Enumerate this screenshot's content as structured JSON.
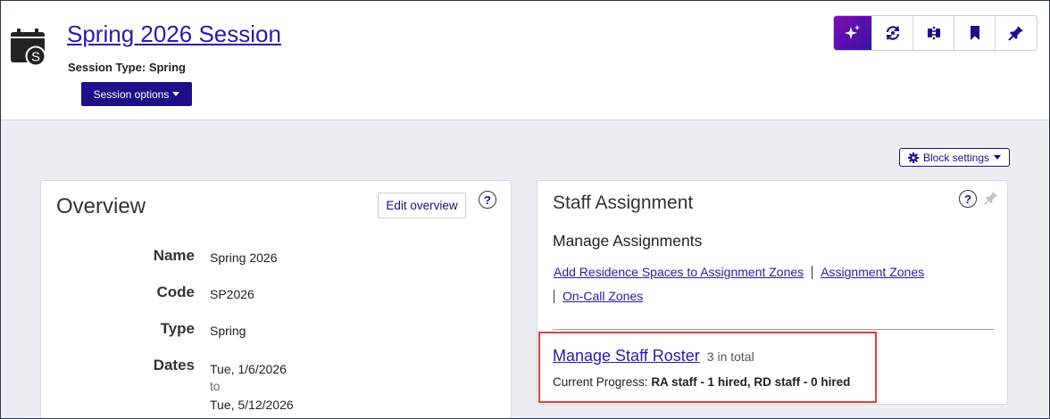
{
  "header": {
    "session_title": "Spring 2026 Session",
    "session_type_label": "Session Type:",
    "session_type_value": "Spring",
    "session_options_label": "Session options"
  },
  "toolbar": {
    "icons": [
      "sparkle-ai-icon",
      "refresh-sync-icon",
      "compare-icon",
      "bookmark-icon",
      "pin-icon"
    ]
  },
  "block_settings_label": "Block settings",
  "overview": {
    "title": "Overview",
    "edit_label": "Edit overview",
    "help": "?",
    "fields": {
      "name_label": "Name",
      "name_value": "Spring 2026",
      "code_label": "Code",
      "code_value": "SP2026",
      "type_label": "Type",
      "type_value": "Spring",
      "dates_label": "Dates",
      "dates_start": "Tue, 1/6/2026",
      "dates_to": "to",
      "dates_end": "Tue, 5/12/2026"
    }
  },
  "staff_assignment": {
    "title": "Staff Assignment",
    "help": "?",
    "manage_assignments": "Manage Assignments",
    "links": {
      "add_spaces": "Add Residence Spaces to Assignment Zones",
      "assignment_zones": "Assignment Zones",
      "on_call_zones": "On-Call Zones"
    },
    "roster": {
      "link_label": "Manage Staff Roster",
      "count": "3 in total",
      "progress_label": "Current Progress:",
      "progress_value": "RA staff - 1 hired, RD staff - 0 hired"
    }
  },
  "colors": {
    "brand_primary": "#1c0f87",
    "link": "#2b1aa6",
    "highlight": "#e04040",
    "background": "#eceef2"
  }
}
